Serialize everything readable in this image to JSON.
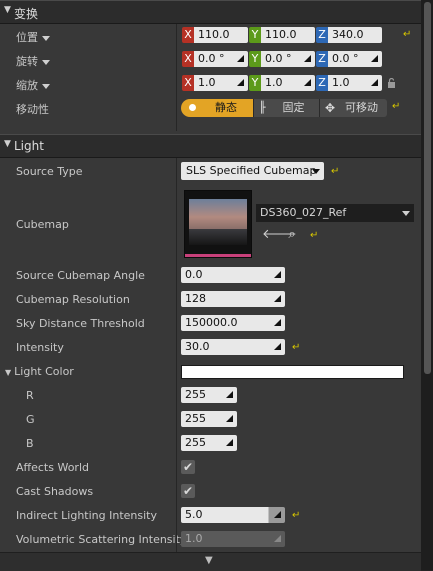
{
  "transform": {
    "header": "变换",
    "location": {
      "label": "位置",
      "x": "110.0",
      "y": "110.0",
      "z": "340.0"
    },
    "rotation": {
      "label": "旋转",
      "x": "0.0 °",
      "y": "0.0 °",
      "z": "0.0 °"
    },
    "scale": {
      "label": "缩放",
      "x": "1.0",
      "y": "1.0",
      "z": "1.0"
    },
    "mobility": {
      "label": "移动性",
      "options": [
        "静态",
        "固定",
        "可移动"
      ],
      "selected": "静态"
    }
  },
  "light": {
    "header": "Light",
    "source_type": {
      "label": "Source Type",
      "value": "SLS Specified Cubemap"
    },
    "cubemap": {
      "label": "Cubemap",
      "asset": "DS360_027_Ref"
    },
    "source_cubemap_angle": {
      "label": "Source Cubemap Angle",
      "value": "0.0"
    },
    "cubemap_resolution": {
      "label": "Cubemap Resolution",
      "value": "128"
    },
    "sky_distance_threshold": {
      "label": "Sky Distance Threshold",
      "value": "150000.0"
    },
    "intensity": {
      "label": "Intensity",
      "value": "30.0"
    },
    "light_color": {
      "label": "Light Color",
      "color": "#ffffff",
      "r_label": "R",
      "r": "255",
      "g_label": "G",
      "g": "255",
      "b_label": "B",
      "b": "255"
    },
    "affects_world": {
      "label": "Affects World",
      "checked": true
    },
    "cast_shadows": {
      "label": "Cast Shadows",
      "checked": true
    },
    "indirect_lighting_intensity": {
      "label": "Indirect Lighting Intensity",
      "value": "5.0",
      "fill": 0.5
    },
    "volumetric_scattering_intensity": {
      "label": "Volumetric Scattering Intensity",
      "value": "1.0"
    }
  },
  "colors": {
    "axis_x": "#b53125",
    "axis_y": "#5c9a1a",
    "axis_z": "#2d68b5",
    "mobility_active": "#e3a425",
    "reset_arrow": "#d7c600"
  },
  "icons": [
    "reset-arrow-icon",
    "lock-icon",
    "browse-arrow-icon",
    "search-icon",
    "move-icon",
    "static-dot-icon",
    "stationary-bulb-icon",
    "more-chevron-icon"
  ]
}
